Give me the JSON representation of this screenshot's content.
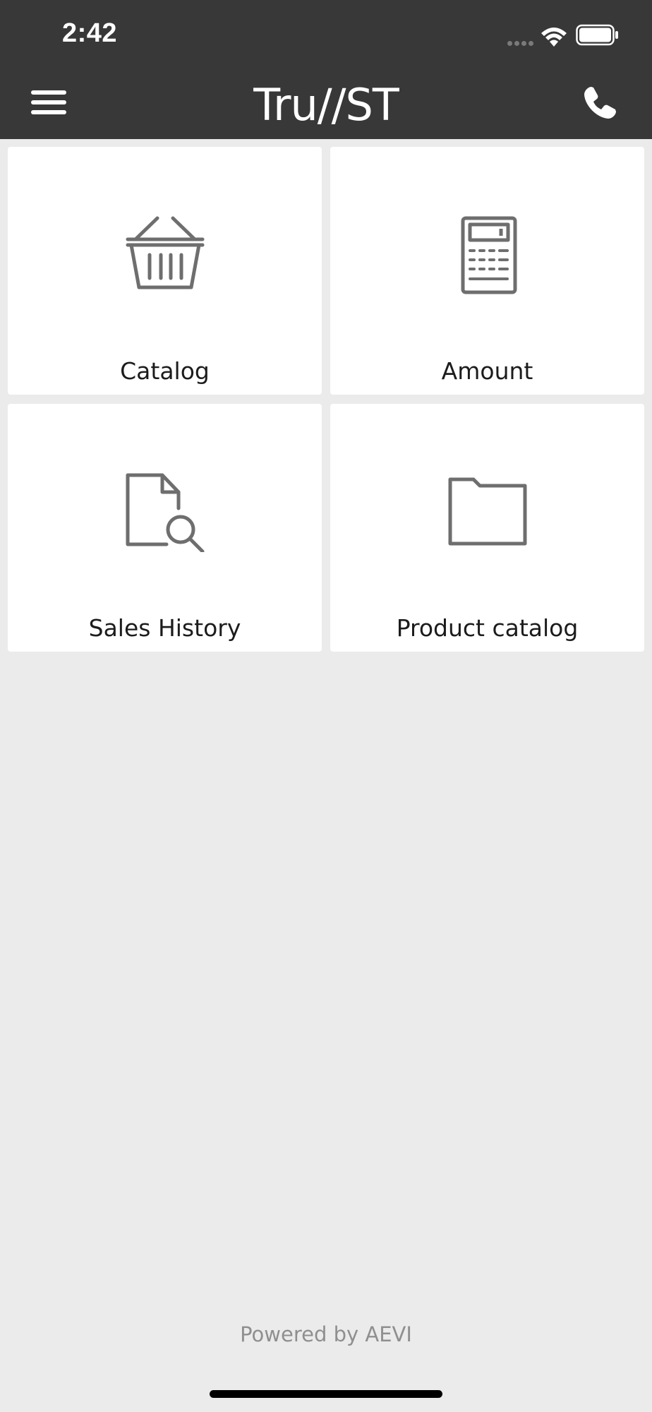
{
  "status_bar": {
    "time": "2:42"
  },
  "header": {
    "title": "Tru//ST"
  },
  "tiles": [
    {
      "label": "Catalog",
      "icon": "basket-icon"
    },
    {
      "label": "Amount",
      "icon": "calculator-icon"
    },
    {
      "label": "Sales History",
      "icon": "document-search-icon"
    },
    {
      "label": "Product catalog",
      "icon": "folder-icon"
    }
  ],
  "footer": {
    "text": "Powered by AEVI"
  },
  "colors": {
    "header_bg": "#383838",
    "page_bg": "#ebebeb",
    "icon_stroke": "#6e6e6e"
  }
}
